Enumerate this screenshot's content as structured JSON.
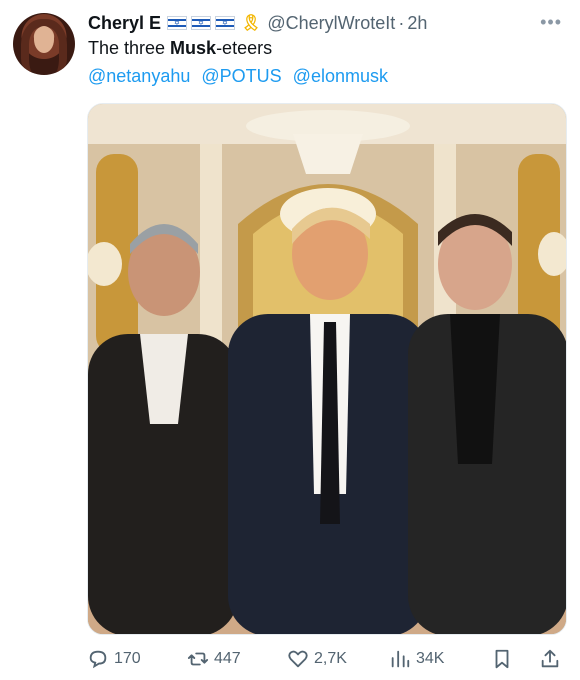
{
  "tweet": {
    "author_name": "Cheryl E",
    "flag_count": 3,
    "ribbon_icon": "yellow-ribbon-icon",
    "handle": "@CherylWroteIt",
    "separator": "·",
    "time": "2h",
    "text_pre": "The three ",
    "text_bold": "Musk",
    "text_post": "-eteers",
    "mentions": [
      "@netanyahu",
      "@POTUS",
      "@elonmusk"
    ]
  },
  "actions": {
    "replies": "170",
    "reposts": "447",
    "likes": "2,7K",
    "views": "34K"
  },
  "colors": {
    "link": "#1d9bf0",
    "muted": "#536471"
  }
}
